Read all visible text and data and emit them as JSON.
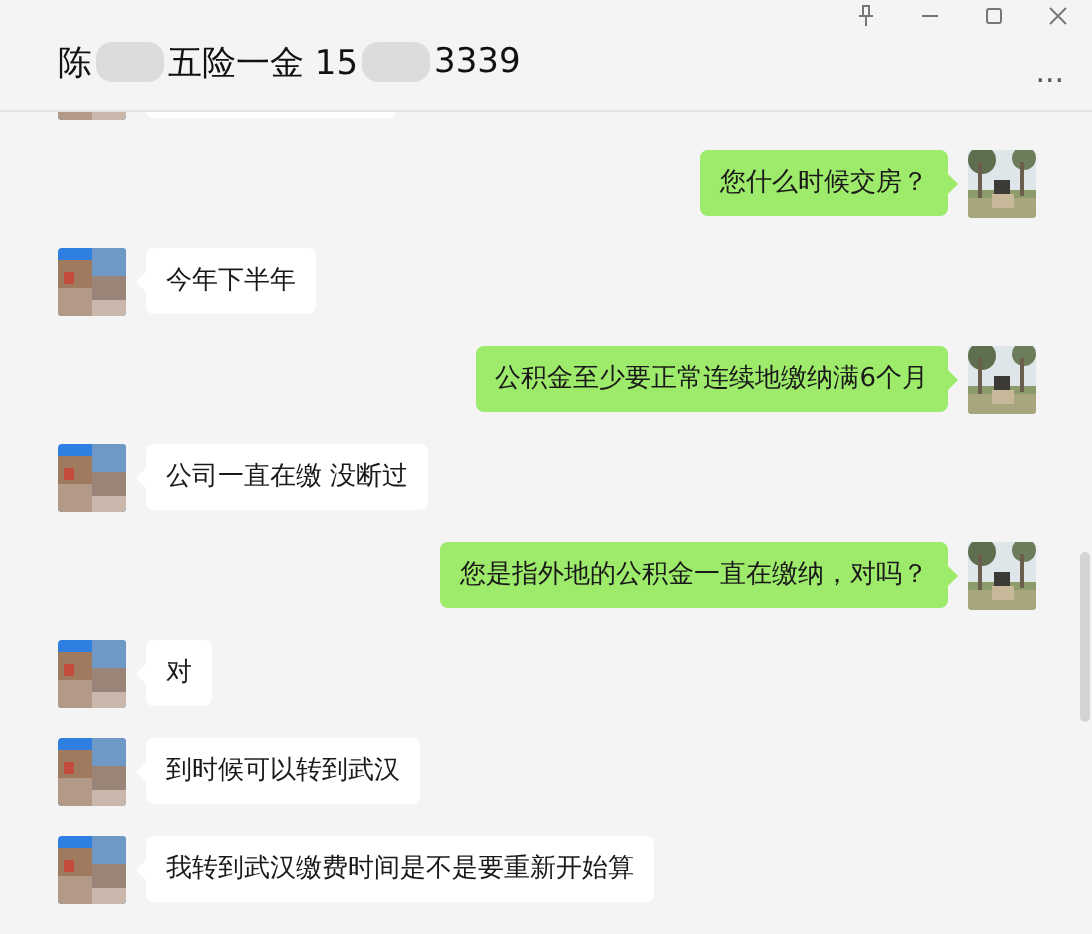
{
  "window": {
    "title_parts": [
      "陈",
      "五险一金 15",
      "3339"
    ],
    "more_button": "..."
  },
  "messages": [
    {
      "kind": "incoming_cut"
    },
    {
      "kind": "outgoing",
      "text": "您什么时候交房？"
    },
    {
      "kind": "incoming",
      "text": "今年下半年"
    },
    {
      "kind": "outgoing",
      "text": "公积金至少要正常连续地缴纳满6个月"
    },
    {
      "kind": "incoming",
      "text": "公司一直在缴  没断过"
    },
    {
      "kind": "outgoing",
      "text": "您是指外地的公积金一直在缴纳，对吗？"
    },
    {
      "kind": "incoming",
      "text": "对"
    },
    {
      "kind": "incoming",
      "text": "到时候可以转到武汉"
    },
    {
      "kind": "incoming",
      "text": "我转到武汉缴费时间是不是要重新开始算"
    }
  ]
}
